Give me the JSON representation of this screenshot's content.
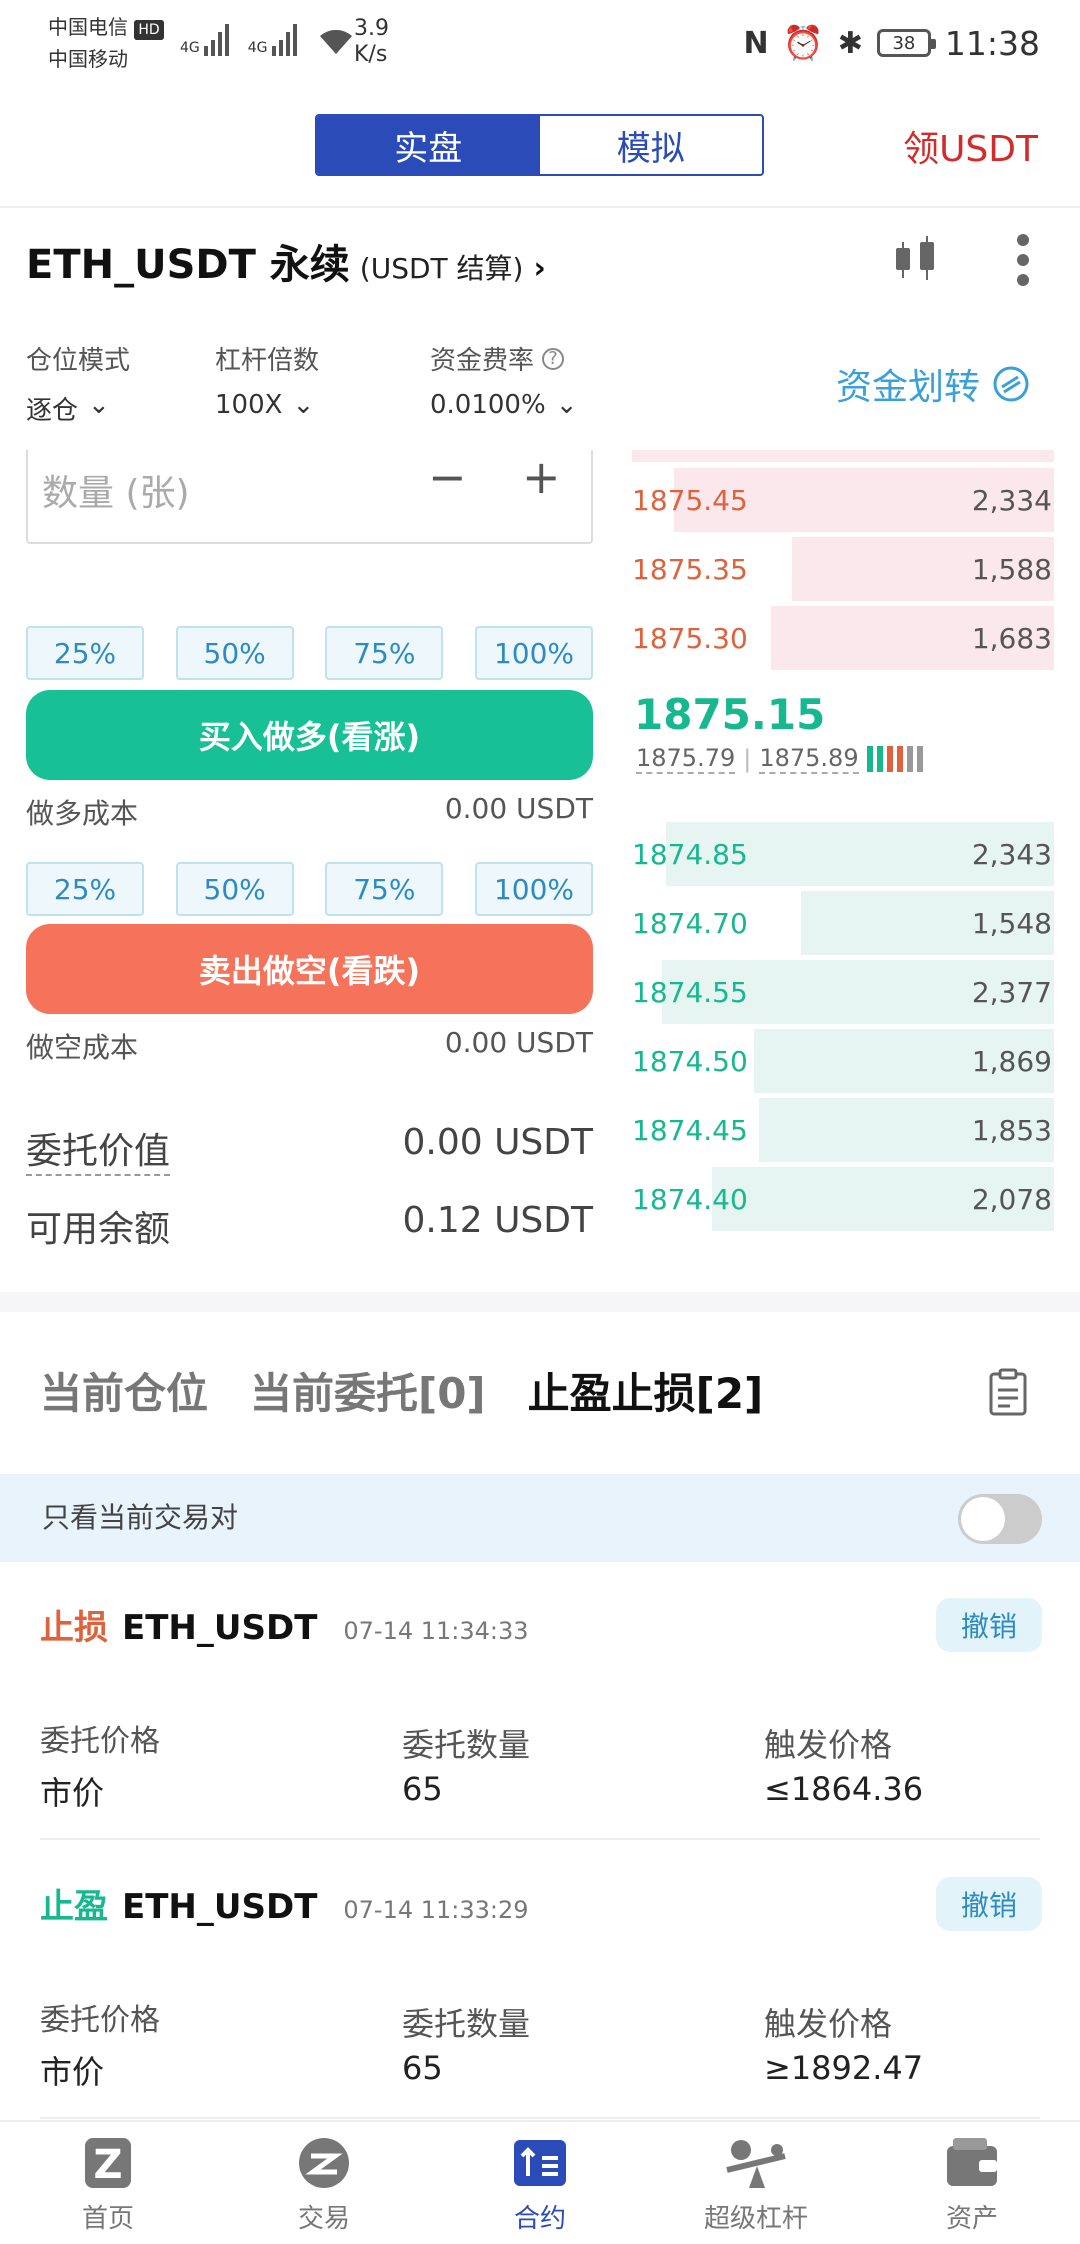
{
  "status_bar": {
    "carrier1": "中国电信",
    "hd_badge": "HD",
    "carrier2": "中国移动",
    "net1": "4G",
    "net2": "4G",
    "speed": "3.9",
    "speed_unit": "K/s",
    "battery": "38",
    "time": "11:38"
  },
  "header": {
    "tabs": [
      {
        "label": "实盘",
        "active": true
      },
      {
        "label": "模拟",
        "active": false
      }
    ],
    "promo": "领USDT"
  },
  "instrument": {
    "pair": "ETH_USDT 永续",
    "settle": "(USDT 结算)"
  },
  "settings": {
    "margin_mode_label": "仓位模式",
    "margin_mode_value": "逐仓",
    "leverage_label": "杠杆倍数",
    "leverage_value": "100X",
    "funding_label": "资金费率",
    "funding_value": "0.0100%",
    "transfer": "资金划转"
  },
  "order_form": {
    "qty_placeholder": "数量 (张)",
    "pct_buttons": [
      "25%",
      "50%",
      "75%",
      "100%"
    ],
    "buy_label": "买入做多(看涨)",
    "long_cost_label": "做多成本",
    "long_cost_value": "0.00 USDT",
    "sell_label": "卖出做空(看跌)",
    "short_cost_label": "做空成本",
    "short_cost_value": "0.00 USDT",
    "order_value_label": "委托价值",
    "order_value": "0.00 USDT",
    "available_label": "可用余额",
    "available_value": "0.12 USDT"
  },
  "order_book": {
    "asks": [
      {
        "price": "1875.45",
        "qty": "2,334",
        "depth": 0.9
      },
      {
        "price": "1875.35",
        "qty": "1,588",
        "depth": 0.62
      },
      {
        "price": "1875.30",
        "qty": "1,683",
        "depth": 0.67
      }
    ],
    "last_price": "1875.15",
    "mark_price": "1875.79",
    "index_price": "1875.89",
    "bids": [
      {
        "price": "1874.85",
        "qty": "2,343",
        "depth": 0.92
      },
      {
        "price": "1874.70",
        "qty": "1,548",
        "depth": 0.6
      },
      {
        "price": "1874.55",
        "qty": "2,377",
        "depth": 0.93
      },
      {
        "price": "1874.50",
        "qty": "1,869",
        "depth": 0.71
      },
      {
        "price": "1874.45",
        "qty": "1,853",
        "depth": 0.7
      },
      {
        "price": "1874.40",
        "qty": "2,078",
        "depth": 0.81
      }
    ]
  },
  "orders_section": {
    "tabs": [
      "当前仓位",
      "当前委托[0]",
      "止盈止损[2]"
    ],
    "filter_label": "只看当前交易对",
    "orders": [
      {
        "type": "止损",
        "type_color": "#e0623c",
        "symbol": "ETH_USDT",
        "time": "07-14 11:34:33",
        "cancel": "撤销",
        "price_label": "委托价格",
        "price": "市价",
        "qty_label": "委托数量",
        "qty": "65",
        "trigger_label": "触发价格",
        "trigger": "≤1864.36"
      },
      {
        "type": "止盈",
        "type_color": "#17b88f",
        "symbol": "ETH_USDT",
        "time": "07-14 11:33:29",
        "cancel": "撤销",
        "price_label": "委托价格",
        "price": "市价",
        "qty_label": "委托数量",
        "qty": "65",
        "trigger_label": "触发价格",
        "trigger": "≥1892.47"
      }
    ]
  },
  "nav": [
    {
      "label": "首页",
      "icon": "home-logo-icon"
    },
    {
      "label": "交易",
      "icon": "trade-icon"
    },
    {
      "label": "合约",
      "icon": "contract-icon",
      "active": true
    },
    {
      "label": "超级杠杆",
      "icon": "leverage-icon"
    },
    {
      "label": "资产",
      "icon": "wallet-icon"
    }
  ],
  "colors": {
    "brand": "#2a4bb8",
    "buy": "#17c195",
    "sell": "#f5735a",
    "promo": "#d32b2b"
  }
}
